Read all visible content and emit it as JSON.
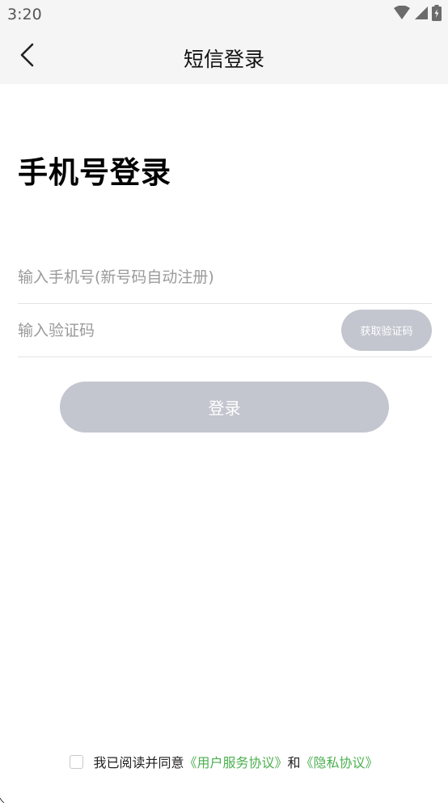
{
  "status_bar": {
    "time": "3:20",
    "icons": [
      "wifi-icon",
      "cellular-signal-icon",
      "battery-charging-icon"
    ]
  },
  "nav": {
    "back_icon": "chevron-left-icon",
    "title": "短信登录"
  },
  "heading": "手机号登录",
  "phone_field": {
    "value": "",
    "placeholder": "输入手机号(新号码自动注册)"
  },
  "code_field": {
    "value": "",
    "placeholder": "输入验证码"
  },
  "get_code_button": "获取验证码",
  "login_button": "登录",
  "agreement": {
    "prefix": "我已阅读并同意",
    "user_agreement": "《用户服务协议》",
    "conjunction": "和",
    "privacy_policy": "《隐私协议》",
    "checked": false
  },
  "colors": {
    "link": "#4caf50",
    "disabled_button": "#c3c6cf",
    "header_bg": "#f5f5f5"
  }
}
